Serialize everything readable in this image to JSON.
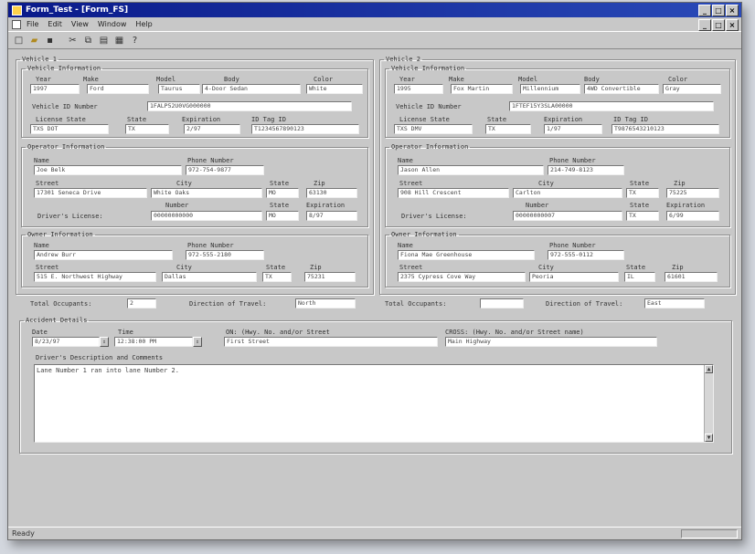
{
  "window": {
    "title": "Form_Test - [Form_FS]"
  },
  "menu": [
    "File",
    "Edit",
    "View",
    "Window",
    "Help"
  ],
  "vehicle1": {
    "section": "Vehicle 1",
    "vi_legend": "Vehicle Information",
    "year_label": "Year",
    "make_label": "Make",
    "model_label": "Model",
    "body_label": "Body",
    "color_label": "Color",
    "year": "1997",
    "make": "Ford",
    "model": "Taurus",
    "body": "4-Door Sedan",
    "color": "White",
    "vin_label": "Vehicle ID Number",
    "vin": "1FALP52U0VG000000",
    "lic_state_label": "License State",
    "state_label": "State",
    "exp_label": "Expiration",
    "tag_label": "ID Tag ID",
    "lic_state": "TXS DOT",
    "state": "TX",
    "exp": "2/97",
    "tag": "T1234567890123",
    "op_legend": "Operator Information",
    "name_label": "Name",
    "phone_label": "Phone Number",
    "op_name": "Joe Belk",
    "op_phone": "972-754-9877",
    "street_label": "Street",
    "city_label": "City",
    "zip_label": "Zip",
    "op_street": "17301 Seneca Drive",
    "op_city": "White Oaks",
    "op_state": "MO",
    "op_zip": "63130",
    "dl_label": "Driver's License:",
    "number_label": "Number",
    "dl_number": "00000000000",
    "dl_state": "MO",
    "dl_exp": "8/97",
    "own_legend": "Owner Information",
    "own_name": "Andrew Burr",
    "own_phone": "972-555-2180",
    "own_street": "515 E. Northwest Highway",
    "own_city": "Dallas",
    "own_state": "TX",
    "own_zip": "75231",
    "occ_label": "Total Occupants:",
    "occ": "2",
    "dir_label": "Direction of Travel:",
    "dir": "North"
  },
  "vehicle2": {
    "section": "Vehicle 2",
    "vi_legend": "Vehicle Information",
    "year_label": "Year",
    "make_label": "Make",
    "model_label": "Model",
    "body_label": "Body",
    "color_label": "Color",
    "year": "1995",
    "make": "Fox Martin",
    "model": "Millennium",
    "body": "4WD Convertible",
    "color": "Gray",
    "vin_label": "Vehicle ID Number",
    "vin": "1FTEF15Y3SLA00000",
    "lic_state_label": "License State",
    "state_label": "State",
    "exp_label": "Expiration",
    "tag_label": "ID Tag ID",
    "lic_state": "TXS DMV",
    "state": "TX",
    "exp": "1/97",
    "tag": "T9876543210123",
    "op_legend": "Operator Information",
    "name_label": "Name",
    "phone_label": "Phone Number",
    "op_name": "Jason Allen",
    "op_phone": "214-749-8123",
    "street_label": "Street",
    "city_label": "City",
    "zip_label": "Zip",
    "op_street": "908 Hill Crescent",
    "op_city": "Carlton",
    "op_state": "TX",
    "op_zip": "75225",
    "dl_label": "Driver's License:",
    "number_label": "Number",
    "dl_number": "00000000007",
    "dl_state": "TX",
    "dl_exp": "6/99",
    "own_legend": "Owner Information",
    "own_name": "Fiona Mae Greenhouse",
    "own_phone": "972-555-0112",
    "own_street": "2375 Cypress Cove Way",
    "own_city": "Peoria",
    "own_state": "IL",
    "own_zip": "61601",
    "occ_label": "Total Occupants:",
    "occ": "",
    "dir_label": "Direction of Travel:",
    "dir": "East"
  },
  "accident": {
    "legend": "Accident Details",
    "date_label": "Date",
    "date": "8/23/97",
    "time_label": "Time",
    "time": "12:38:00 PM",
    "on_label": "ON:  (Hwy. No. and/or Street",
    "on_value": "First Street",
    "cross_label": "CROSS:  (Hwy. No. and/or Street name)",
    "cross_value": "Main Highway",
    "narr_label": "Driver's Description and Comments",
    "narrative": "Lane Number 1 ran into lane Number 2."
  },
  "status": {
    "text": "Ready"
  }
}
